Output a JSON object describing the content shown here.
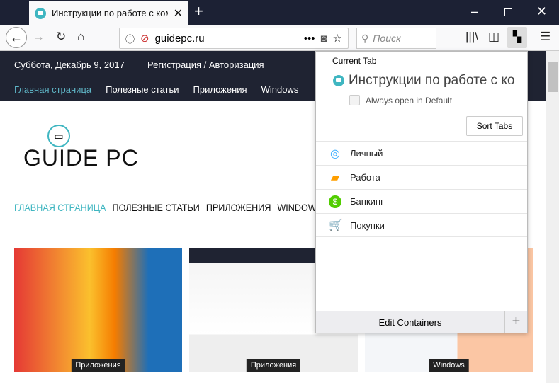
{
  "browser": {
    "tab_title": "Инструкции по работе с комп",
    "url": "guidepc.ru",
    "search_placeholder": "Поиск"
  },
  "site": {
    "date": "Суббота, Декабрь 9, 2017",
    "auth": "Регистрация / Авторизация",
    "top_nav": [
      "Главная страница",
      "Полезные статьи",
      "Приложения",
      "Windows"
    ],
    "logo": "GUIDE PC",
    "main_nav": [
      "ГЛАВНАЯ СТРАНИЦА",
      "ПОЛЕЗНЫЕ СТАТЬИ",
      "ПРИЛОЖЕНИЯ",
      "WINDOWS"
    ],
    "cards": [
      {
        "category": "Приложения"
      },
      {
        "category": "Приложения"
      },
      {
        "category": "Windows"
      }
    ]
  },
  "popup": {
    "heading": "Current Tab",
    "tab_title": "Инструкции по работе с ко",
    "always_open": "Always open in Default",
    "sort_tabs": "Sort Tabs",
    "containers": [
      {
        "name": "Личный",
        "icon": "fingerprint-icon",
        "color": "#37adff"
      },
      {
        "name": "Работа",
        "icon": "briefcase-icon",
        "color": "#ff9f00"
      },
      {
        "name": "Банкинг",
        "icon": "dollar-icon",
        "color": "#51cd00"
      },
      {
        "name": "Покупки",
        "icon": "cart-icon",
        "color": "#ff4bda"
      }
    ],
    "edit_containers": "Edit Containers",
    "add": "+"
  }
}
